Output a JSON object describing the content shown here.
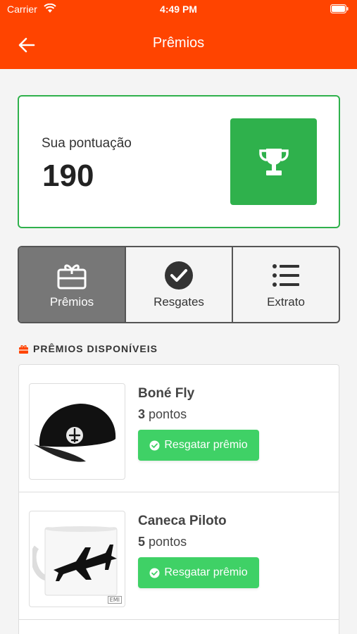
{
  "status_bar": {
    "carrier": "Carrier",
    "time": "4:49 PM"
  },
  "header": {
    "title": "Prêmios",
    "back_icon": "arrow-left-icon"
  },
  "score": {
    "label": "Sua pontuação",
    "value": "190",
    "icon": "trophy-icon",
    "accent": "#2fb14c"
  },
  "tabs": [
    {
      "label": "Prêmios",
      "icon": "gift-icon",
      "active": true
    },
    {
      "label": "Resgates",
      "icon": "check-circle-icon",
      "active": false
    },
    {
      "label": "Extrato",
      "icon": "list-icon",
      "active": false
    }
  ],
  "section": {
    "title": "PRÊMIOS DISPONÍVEIS",
    "icon": "gift-icon"
  },
  "prizes": [
    {
      "name": "Boné Fly",
      "points_value": "3",
      "points_unit": "pontos",
      "button": "Resgatar prêmio",
      "image": "cap-image"
    },
    {
      "name": "Caneca Piloto",
      "points_value": "5",
      "points_unit": "pontos",
      "button": "Resgatar prêmio",
      "image": "mug-image",
      "image_badge": "EMI"
    }
  ],
  "colors": {
    "header": "#ff4400",
    "success": "#2fb14c",
    "button": "#3fd166"
  }
}
